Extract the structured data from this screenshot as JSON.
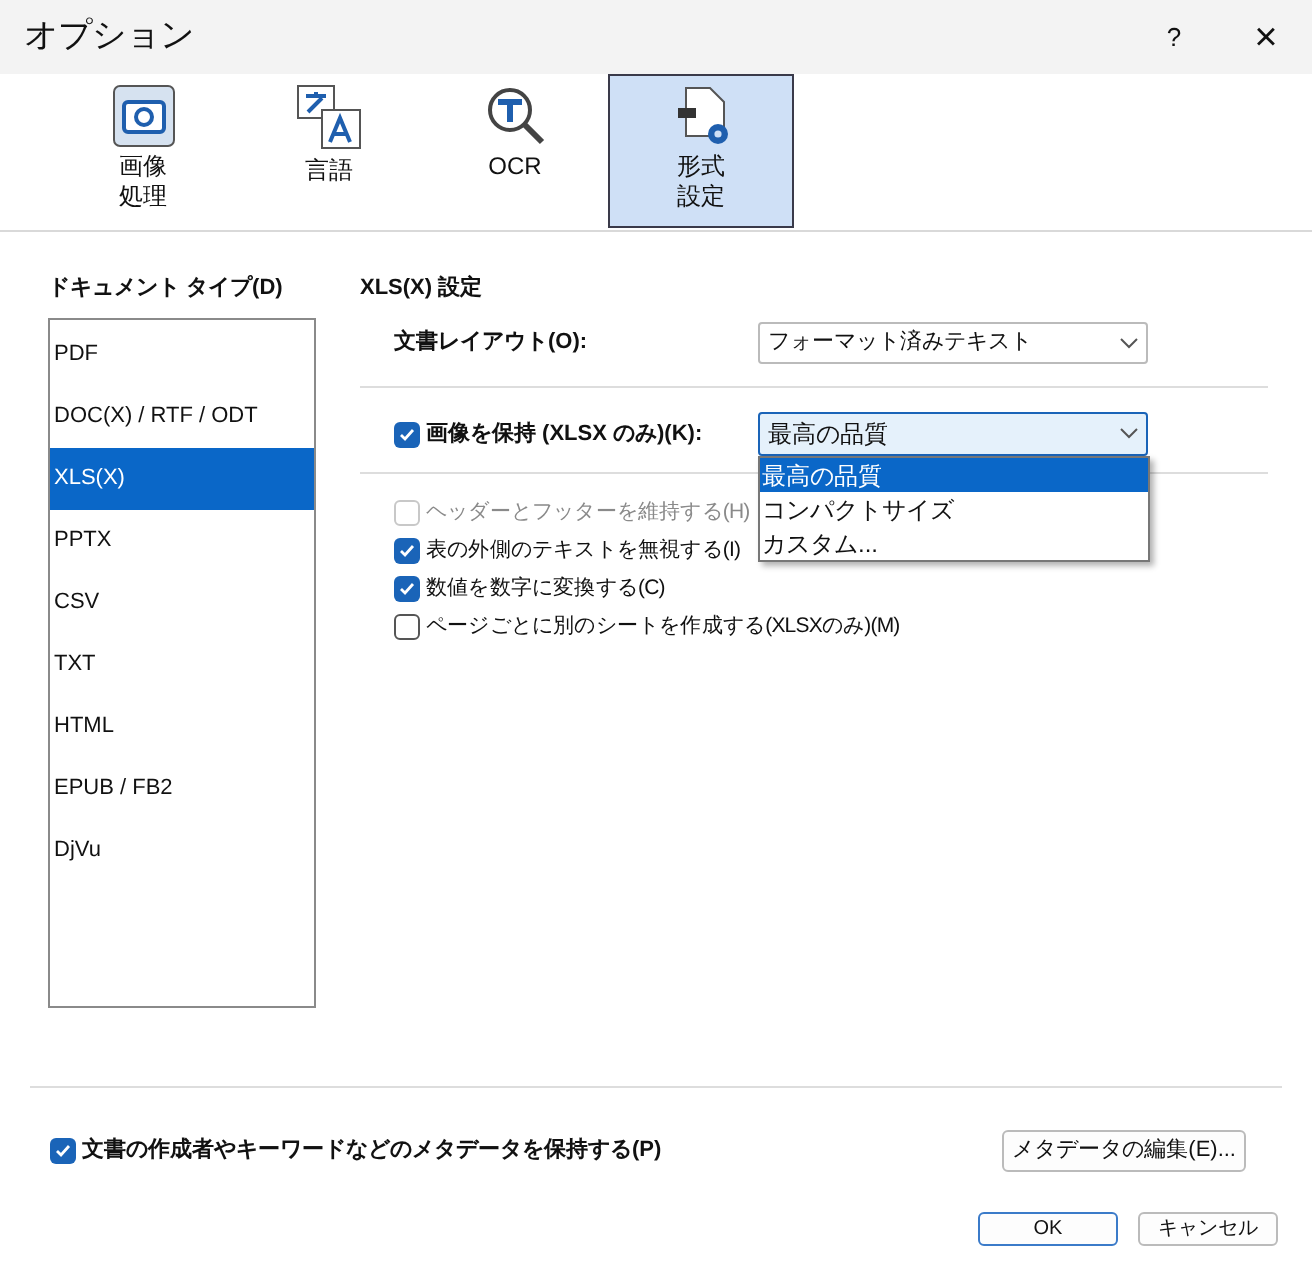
{
  "window": {
    "title": "オプション",
    "help": "?",
    "close": "×"
  },
  "toolbar": [
    {
      "label_lines": [
        "画像",
        "処理"
      ],
      "selected": false
    },
    {
      "label_lines": [
        "言語"
      ],
      "selected": false
    },
    {
      "label_lines": [
        "OCR"
      ],
      "selected": false
    },
    {
      "label_lines": [
        "形式",
        "設定"
      ],
      "selected": true
    }
  ],
  "document_types": {
    "label": "ドキュメント タイプ(D)",
    "items": [
      {
        "label": "PDF",
        "selected": false
      },
      {
        "label": "DOC(X) / RTF / ODT",
        "selected": false
      },
      {
        "label": "XLS(X)",
        "selected": true
      },
      {
        "label": "PPTX",
        "selected": false
      },
      {
        "label": "CSV",
        "selected": false
      },
      {
        "label": "TXT",
        "selected": false
      },
      {
        "label": "HTML",
        "selected": false
      },
      {
        "label": "EPUB / FB2",
        "selected": false
      },
      {
        "label": "DjVu",
        "selected": false
      }
    ]
  },
  "settings": {
    "heading": "XLS(X) 設定",
    "layout": {
      "label": "文書レイアウト(O):",
      "value": "フォーマット済みテキスト"
    },
    "keep_images": {
      "label": "画像を保持 (XLSX のみ)(K):",
      "checked": true,
      "value": "最高の品質",
      "expanded": true,
      "options": [
        {
          "label": "最高の品質",
          "selected": true
        },
        {
          "label": "コンパクトサイズ",
          "selected": false
        },
        {
          "label": "カスタム...",
          "selected": false
        }
      ]
    },
    "options": [
      {
        "label": "ヘッダーとフッターを維持する(H)",
        "checked": false,
        "disabled": true
      },
      {
        "label": "表の外側のテキストを無視する(I)",
        "checked": true,
        "disabled": false
      },
      {
        "label": "数値を数字に変換する(C)",
        "checked": true,
        "disabled": false
      },
      {
        "label": "ページごとに別のシートを作成する(XLSXのみ)(M)",
        "checked": false,
        "disabled": false
      }
    ]
  },
  "metadata": {
    "label": "文書の作成者やキーワードなどのメタデータを保持する(P)",
    "checked": true,
    "button": "メタデータの編集(E)..."
  },
  "buttons": [
    {
      "label": "OK",
      "kind": "default"
    },
    {
      "label": "キャンセル",
      "kind": "normal"
    }
  ]
}
